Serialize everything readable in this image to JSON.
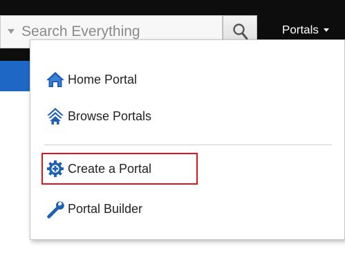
{
  "search": {
    "placeholder": "Search Everything",
    "value": ""
  },
  "header": {
    "portals_label": "Portals"
  },
  "menu": {
    "items": [
      {
        "label": "Home Portal",
        "icon": "home-icon"
      },
      {
        "label": "Browse Portals",
        "icon": "browse-portals-icon"
      },
      {
        "label": "Create a Portal",
        "icon": "create-portal-icon",
        "highlighted": true
      },
      {
        "label": "Portal Builder",
        "icon": "wrench-icon"
      }
    ]
  },
  "colors": {
    "icon_blue": "#1f5fb4",
    "highlight_red": "#e0141c",
    "header_bg": "#0d0d0d",
    "band_blue": "#1e67c4"
  }
}
